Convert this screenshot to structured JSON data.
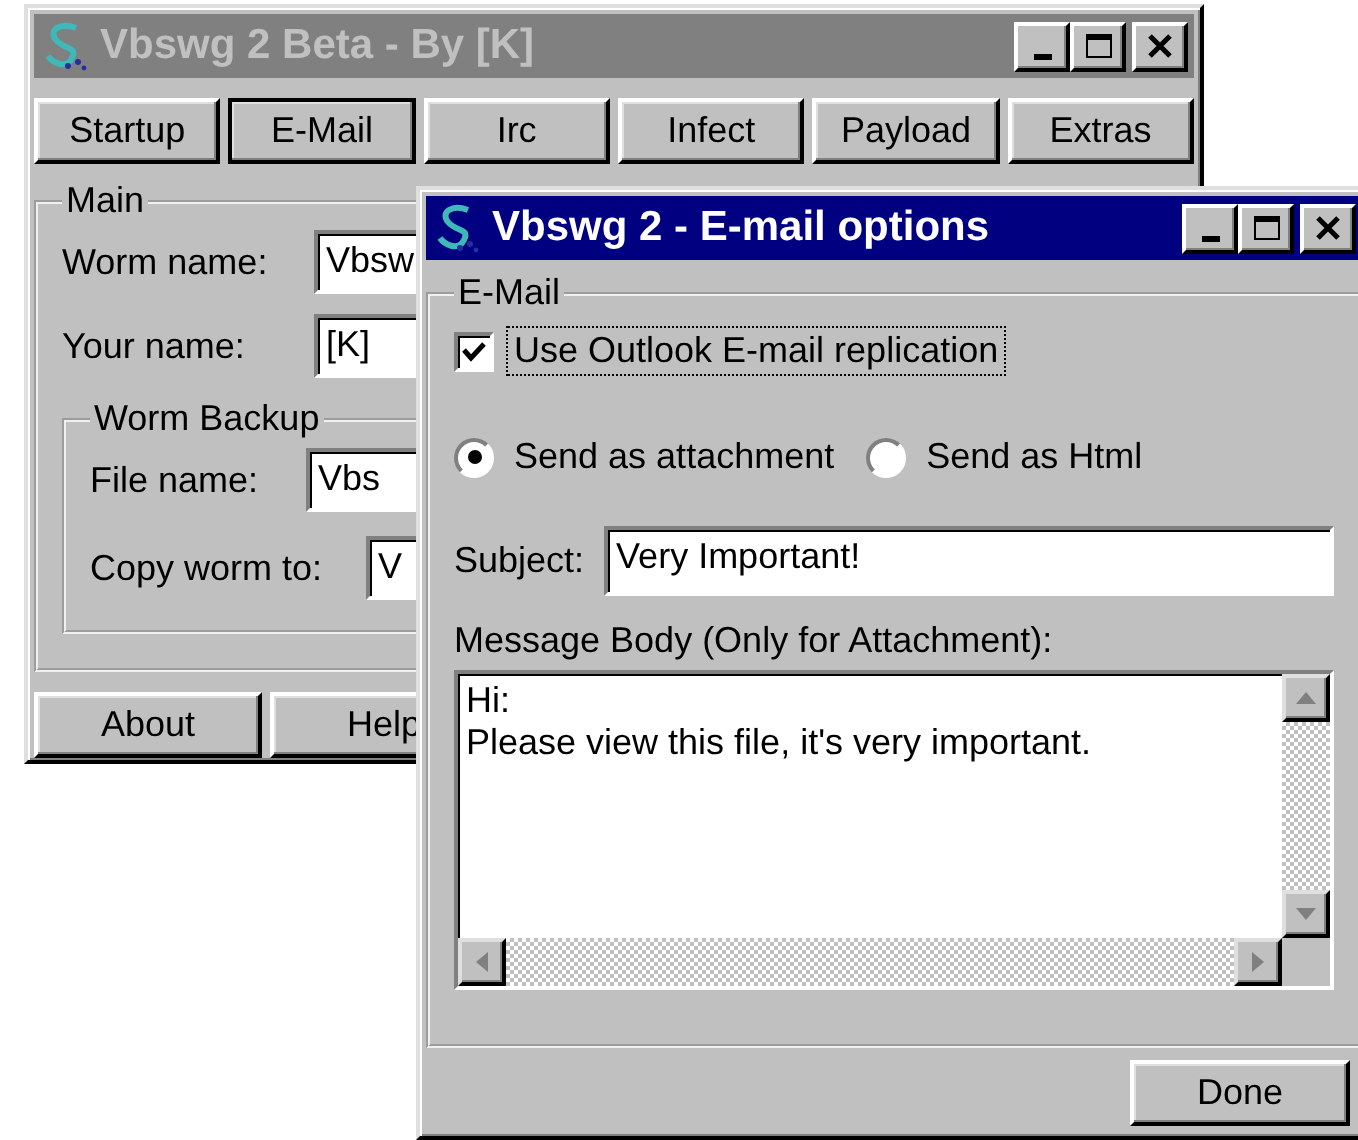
{
  "main_window": {
    "title": "Vbswg 2 Beta - By [K]",
    "active": false,
    "tabs": [
      {
        "label": "Startup",
        "selected": false
      },
      {
        "label": "E-Mail",
        "selected": true
      },
      {
        "label": "Irc",
        "selected": false
      },
      {
        "label": "Infect",
        "selected": false
      },
      {
        "label": "Payload",
        "selected": false
      },
      {
        "label": "Extras",
        "selected": false
      }
    ],
    "main_group": {
      "title": "Main",
      "fields": [
        {
          "label": "Worm name:",
          "value": "Vbsw"
        },
        {
          "label": "Your name:",
          "value": "[K]"
        }
      ]
    },
    "backup_group": {
      "title": "Worm Backup",
      "fields": [
        {
          "label": "File name:",
          "value": "Vbs"
        },
        {
          "label": "Copy worm to:",
          "value": "V"
        }
      ]
    },
    "buttons": [
      "About",
      "Help"
    ]
  },
  "email_window": {
    "title": "Vbswg 2 - E-mail options",
    "active": true,
    "group": {
      "title": "E-Mail",
      "replication": {
        "label": "Use Outlook E-mail replication",
        "checked": true,
        "focused": true
      },
      "send_options": [
        {
          "label": "Send as attachment",
          "selected": true
        },
        {
          "label": "Send as Html",
          "selected": false
        }
      ],
      "subject": {
        "label": "Subject:",
        "value": "Very Important!"
      },
      "body": {
        "label": "Message Body (Only for Attachment):",
        "lines": [
          "Hi:",
          "Please view this file, it's very important."
        ]
      }
    },
    "buttons": [
      "Done"
    ]
  }
}
